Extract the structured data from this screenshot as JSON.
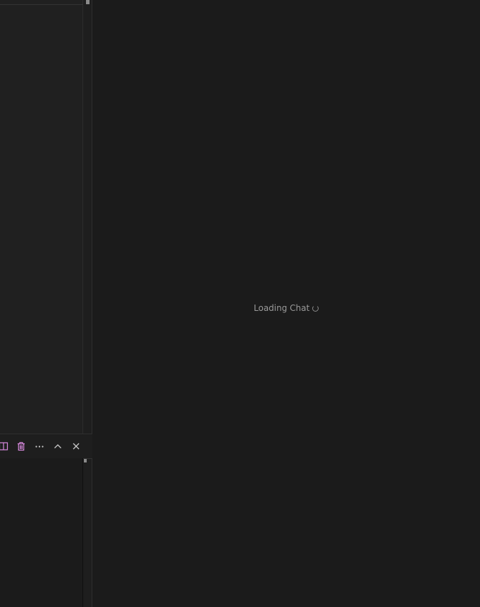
{
  "chat": {
    "loading_text": "Loading Chat",
    "spinner_icon": "loading-spinner-icon"
  },
  "panel": {
    "toolbar_icons": [
      "split-terminal-icon",
      "trash-icon",
      "more-actions-icon",
      "maximize-panel-icon",
      "close-icon"
    ]
  },
  "colors": {
    "background": "#1b1b1b",
    "accent_icon": "#d98adf",
    "text_muted": "#9a9a9a"
  }
}
